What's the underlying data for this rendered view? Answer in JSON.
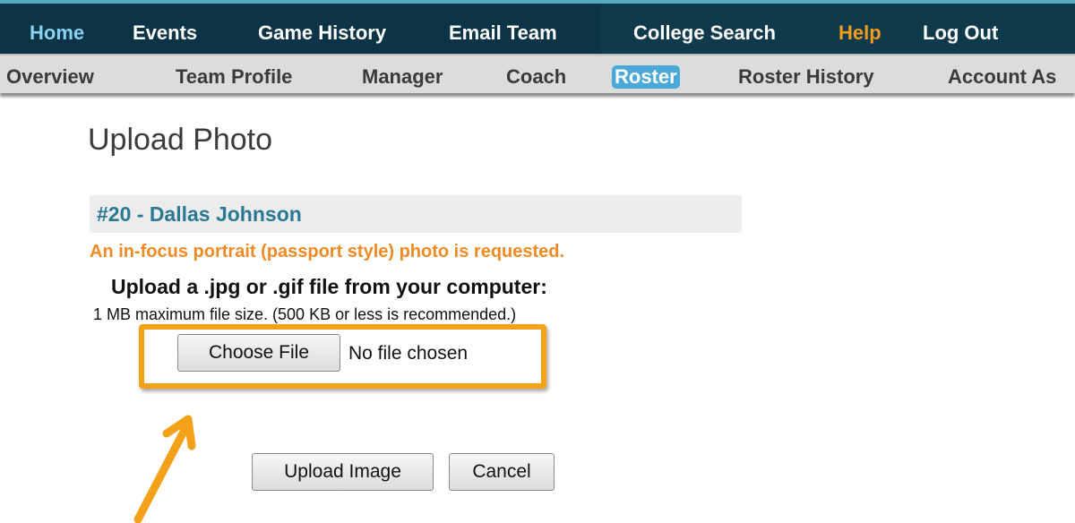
{
  "top_nav": {
    "items": [
      {
        "label": "Home"
      },
      {
        "label": "Events"
      },
      {
        "label": "Game History"
      },
      {
        "label": "Email Team"
      },
      {
        "label": "College Search"
      },
      {
        "label": "Help"
      },
      {
        "label": "Log Out"
      }
    ],
    "active": "Home",
    "colors": {
      "background": "#0e3a4c",
      "active": "#8ad3f2",
      "help": "#f39c1f"
    }
  },
  "sub_nav": {
    "items": [
      {
        "label": "Overview"
      },
      {
        "label": "Team Profile"
      },
      {
        "label": "Manager"
      },
      {
        "label": "Coach"
      },
      {
        "label": "Roster"
      },
      {
        "label": "Roster History"
      },
      {
        "label": "Account As"
      }
    ],
    "active": "Roster",
    "colors": {
      "background": "#dcdcdc",
      "active": "#4aa9d6"
    }
  },
  "page": {
    "title": "Upload Photo",
    "player": "#20 - Dallas Johnson",
    "request_note": "An in-focus portrait (passport style) photo is requested.",
    "upload_heading": "Upload a .jpg or .gif file from your computer:",
    "size_note": "1 MB maximum file size. (500 KB or less is recommended.)"
  },
  "file_input": {
    "button_label": "Choose File",
    "status": "No file chosen"
  },
  "actions": {
    "upload_label": "Upload Image",
    "cancel_label": "Cancel"
  },
  "annotation": {
    "highlight_color": "#f2a119",
    "icon": "arrow-up-right-icon"
  }
}
